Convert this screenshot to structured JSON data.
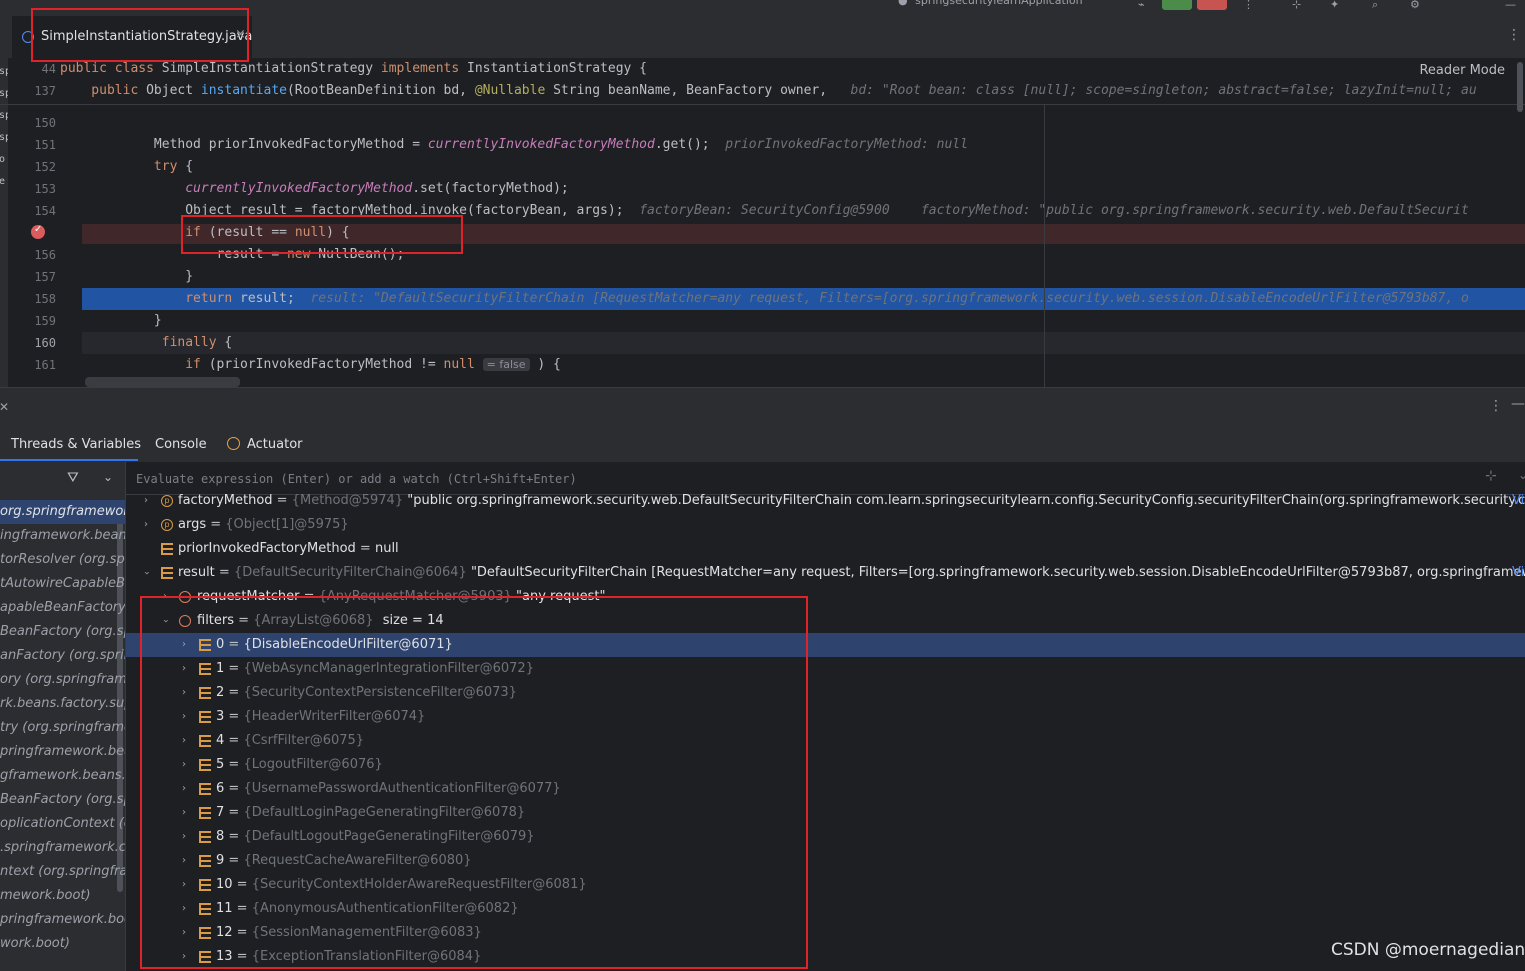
{
  "top": {
    "run_config": "springsecuritylearnApplication"
  },
  "tab": {
    "title": "SimpleInstantiationStrategy.java",
    "close": "×",
    "more": "⋮"
  },
  "editor": {
    "reader_mode": "Reader Mode",
    "left_strip_chars": [
      "sp",
      "sp",
      "sp",
      "sp",
      "o",
      "e"
    ],
    "lines": [
      {
        "num": "44",
        "parts": [
          {
            "t": "public class ",
            "c": "kw"
          },
          {
            "t": "SimpleInstantiationStrategy ",
            "c": ""
          },
          {
            "t": "implements ",
            "c": "kw"
          },
          {
            "t": "InstantiationStrategy {",
            "c": ""
          }
        ]
      },
      {
        "num": "137",
        "parts": [
          {
            "t": "    public ",
            "c": "kw"
          },
          {
            "t": "Object ",
            "c": ""
          },
          {
            "t": "instantiate",
            "c": "fn"
          },
          {
            "t": "(RootBeanDefinition bd, ",
            "c": ""
          },
          {
            "t": "@Nullable ",
            "c": "ann"
          },
          {
            "t": "String beanName, BeanFactory owner,   ",
            "c": ""
          },
          {
            "t": "bd: \"Root bean: class [null]; scope=singleton; abstract=false; lazyInit=null; au",
            "c": "inl"
          }
        ]
      },
      {
        "num": "150",
        "parts": [
          {
            "t": "",
            "c": ""
          }
        ]
      },
      {
        "num": "151",
        "parts": [
          {
            "t": "            Method priorInvokedFactoryMethod = ",
            "c": ""
          },
          {
            "t": "currentlyInvokedFactoryMethod",
            "c": "sf"
          },
          {
            "t": ".get();  ",
            "c": ""
          },
          {
            "t": "priorInvokedFactoryMethod: null",
            "c": "inl"
          }
        ]
      },
      {
        "num": "152",
        "parts": [
          {
            "t": "            ",
            "c": ""
          },
          {
            "t": "try ",
            "c": "kw"
          },
          {
            "t": "{",
            "c": ""
          }
        ]
      },
      {
        "num": "153",
        "parts": [
          {
            "t": "                ",
            "c": ""
          },
          {
            "t": "currentlyInvokedFactoryMethod",
            "c": "sf"
          },
          {
            "t": ".set(factoryMethod);",
            "c": ""
          }
        ]
      },
      {
        "num": "154",
        "parts": [
          {
            "t": "                Object result = factoryMethod.invoke(factoryBean, args);  ",
            "c": ""
          },
          {
            "t": "factoryBean: SecurityConfig@5900    factoryMethod: \"public org.springframework.security.web.DefaultSecurit",
            "c": "inl"
          }
        ]
      },
      {
        "num": "",
        "parts": [
          {
            "t": "                ",
            "c": ""
          },
          {
            "t": "if ",
            "c": "kw"
          },
          {
            "t": "(result == ",
            "c": ""
          },
          {
            "t": "null",
            "c": "nl"
          },
          {
            "t": ") {",
            "c": ""
          }
        ]
      },
      {
        "num": "156",
        "parts": [
          {
            "t": "                    result = ",
            "c": ""
          },
          {
            "t": "new ",
            "c": "kw"
          },
          {
            "t": "NullBean();",
            "c": ""
          }
        ]
      },
      {
        "num": "157",
        "parts": [
          {
            "t": "                }",
            "c": ""
          }
        ]
      },
      {
        "num": "158",
        "parts": [
          {
            "t": "                ",
            "c": ""
          },
          {
            "t": "return ",
            "c": "kw"
          },
          {
            "t": "result;  ",
            "c": ""
          },
          {
            "t": "result: \"DefaultSecurityFilterChain [RequestMatcher=any request, Filters=[org.springframework.security.web.session.DisableEncodeUrlFilter@5793b87, o",
            "c": "inl"
          }
        ]
      },
      {
        "num": "159",
        "parts": [
          {
            "t": "            }",
            "c": ""
          }
        ]
      },
      {
        "num": "160",
        "parts": [
          {
            "t": "             ",
            "c": ""
          },
          {
            "t": "finally ",
            "c": "kw"
          },
          {
            "t": "{",
            "c": ""
          }
        ]
      },
      {
        "num": "161",
        "parts": [
          {
            "t": "                ",
            "c": ""
          },
          {
            "t": "if ",
            "c": "kw"
          },
          {
            "t": "(priorInvokedFactoryMethod != ",
            "c": ""
          },
          {
            "t": "null",
            "c": "nl"
          }
        ]
      }
    ],
    "hint_false": "= false",
    "line161_tail": " ) {"
  },
  "debug": {
    "tabs": [
      "Threads & Variables",
      "Console",
      "Actuator"
    ],
    "eval_placeholder": "Evaluate expression (Enter) or add a watch (Ctrl+Shift+Enter)",
    "frames": [
      "org.springframework.",
      "ingframework.beans.",
      "torResolver (org.spri",
      "tAutowireCapableBea",
      "apableBeanFactory (o",
      "BeanFactory (org.spr",
      "anFactory (org.spring",
      "ory (org.springframe",
      "rk.beans.factory.supp",
      "try (org.springframew",
      "pringframework.beans",
      "gframework.beans.fa",
      "BeanFactory (org.spri",
      "oplicationContext (org",
      ".springframework.con",
      "ntext (org.springframe",
      "mework.boot)",
      "pringframework.boot.",
      "work.boot)"
    ],
    "vars": {
      "factoryMethod": {
        "name": "factoryMethod",
        "type": "{Method@5974}",
        "value": "\"public org.springframework.security.web.DefaultSecurityFilterChain com.learn.springsecuritylearn.config.SecurityConfig.securityFilterChain(org.springframework.security.config.annotation.web.bu...",
        "link": "Vi"
      },
      "args": {
        "name": "args",
        "type": "{Object[1]@5975}"
      },
      "prior": {
        "name": "priorInvokedFactoryMethod",
        "value": "null"
      },
      "result": {
        "name": "result",
        "type": "{DefaultSecurityFilterChain@6064}",
        "value": "\"DefaultSecurityFilterChain [RequestMatcher=any request, Filters=[org.springframework.security.web.session.DisableEncodeUrlFilter@5793b87, org.springframework.security.web.context...",
        "link": "Vi"
      },
      "requestMatcher": {
        "name": "requestMatcher",
        "type": "{AnyRequestMatcher@5903}",
        "value": "\"any request\""
      },
      "filters": {
        "name": "filters",
        "type": "{ArrayList@6068}",
        "size": "size = 14"
      },
      "items": [
        {
          "idx": "0",
          "val": "{DisableEncodeUrlFilter@6071}"
        },
        {
          "idx": "1",
          "val": "{WebAsyncManagerIntegrationFilter@6072}"
        },
        {
          "idx": "2",
          "val": "{SecurityContextPersistenceFilter@6073}"
        },
        {
          "idx": "3",
          "val": "{HeaderWriterFilter@6074}"
        },
        {
          "idx": "4",
          "val": "{CsrfFilter@6075}"
        },
        {
          "idx": "5",
          "val": "{LogoutFilter@6076}"
        },
        {
          "idx": "6",
          "val": "{UsernamePasswordAuthenticationFilter@6077}"
        },
        {
          "idx": "7",
          "val": "{DefaultLoginPageGeneratingFilter@6078}"
        },
        {
          "idx": "8",
          "val": "{DefaultLogoutPageGeneratingFilter@6079}"
        },
        {
          "idx": "9",
          "val": "{RequestCacheAwareFilter@6080}"
        },
        {
          "idx": "10",
          "val": "{SecurityContextHolderAwareRequestFilter@6081}"
        },
        {
          "idx": "11",
          "val": "{AnonymousAuthenticationFilter@6082}"
        },
        {
          "idx": "12",
          "val": "{SessionManagementFilter@6083}"
        },
        {
          "idx": "13",
          "val": "{ExceptionTranslationFilter@6084}"
        }
      ]
    }
  },
  "watermark": "CSDN @moernagedian",
  "colors": {
    "accent": "#3574f0",
    "breakpoint": "#db5c5c",
    "exec_line": "#2154a3",
    "annotation_box": "#e0222a"
  }
}
